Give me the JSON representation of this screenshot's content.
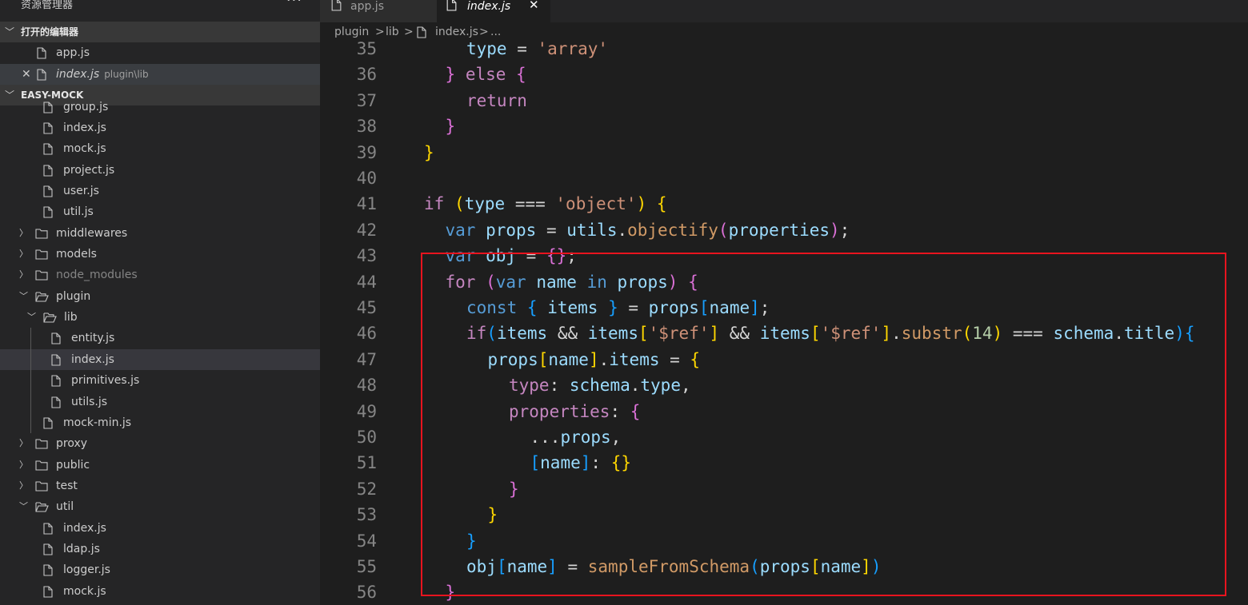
{
  "explorer": {
    "title": "资源管理器",
    "more": "···",
    "open_editors_title": "打开的编辑器",
    "open_editors": [
      {
        "name": "app.js",
        "desc": ""
      },
      {
        "name": "index.js",
        "desc": "plugin\\lib",
        "active": true
      }
    ],
    "project_title": "EASY-MOCK",
    "tree": [
      {
        "name": "group.js",
        "type": "file",
        "depth": 1
      },
      {
        "name": "index.js",
        "type": "file",
        "depth": 1
      },
      {
        "name": "mock.js",
        "type": "file",
        "depth": 1
      },
      {
        "name": "project.js",
        "type": "file",
        "depth": 1
      },
      {
        "name": "user.js",
        "type": "file",
        "depth": 1
      },
      {
        "name": "util.js",
        "type": "file",
        "depth": 1
      },
      {
        "name": "middlewares",
        "type": "folder",
        "depth": 0
      },
      {
        "name": "models",
        "type": "folder",
        "depth": 0
      },
      {
        "name": "node_modules",
        "type": "folder",
        "depth": 0,
        "dim": true
      },
      {
        "name": "plugin",
        "type": "folder-open",
        "depth": 0
      },
      {
        "name": "lib",
        "type": "folder-open",
        "depth": 1
      },
      {
        "name": "entity.js",
        "type": "file",
        "depth": 2
      },
      {
        "name": "index.js",
        "type": "file",
        "depth": 2,
        "selected": true
      },
      {
        "name": "primitives.js",
        "type": "file",
        "depth": 2
      },
      {
        "name": "utils.js",
        "type": "file",
        "depth": 2
      },
      {
        "name": "mock-min.js",
        "type": "file",
        "depth": 1
      },
      {
        "name": "proxy",
        "type": "folder",
        "depth": 0
      },
      {
        "name": "public",
        "type": "folder",
        "depth": 0
      },
      {
        "name": "test",
        "type": "folder",
        "depth": 0
      },
      {
        "name": "util",
        "type": "folder-open",
        "depth": 0
      },
      {
        "name": "index.js",
        "type": "file",
        "depth": 1
      },
      {
        "name": "ldap.js",
        "type": "file",
        "depth": 1
      },
      {
        "name": "logger.js",
        "type": "file",
        "depth": 1
      },
      {
        "name": "mock.js",
        "type": "file",
        "depth": 1
      }
    ]
  },
  "tabs": [
    {
      "label": "app.js",
      "active": false
    },
    {
      "label": "index.js",
      "active": true,
      "close": "✕"
    }
  ],
  "breadcrumb": {
    "p1": "plugin",
    "sep": ">",
    "p2": "lib",
    "p3": "index.js",
    "p4": "..."
  },
  "editor": {
    "lines": [
      {
        "n": "35",
        "indent": 2,
        "tokens": [
          [
            "vr",
            "type"
          ],
          [
            "pu",
            " = "
          ],
          [
            "st",
            "'array'"
          ]
        ]
      },
      {
        "n": "36",
        "indent": 1,
        "tokens": [
          [
            "b2",
            "}"
          ],
          [
            "pu",
            " "
          ],
          [
            "kw",
            "else"
          ],
          [
            "pu",
            " "
          ],
          [
            "b2",
            "{"
          ]
        ]
      },
      {
        "n": "37",
        "indent": 2,
        "tokens": [
          [
            "kw",
            "return"
          ]
        ]
      },
      {
        "n": "38",
        "indent": 1,
        "tokens": [
          [
            "b2",
            "}"
          ]
        ]
      },
      {
        "n": "39",
        "indent": 0,
        "tokens": [
          [
            "b1",
            "}"
          ]
        ]
      },
      {
        "n": "40",
        "indent": 0,
        "tokens": []
      },
      {
        "n": "41",
        "indent": 0,
        "tokens": [
          [
            "kw",
            "if"
          ],
          [
            "pu",
            " "
          ],
          [
            "b1",
            "("
          ],
          [
            "vr",
            "type"
          ],
          [
            "pu",
            " === "
          ],
          [
            "st",
            "'object'"
          ],
          [
            "b1",
            ")"
          ],
          [
            "pu",
            " "
          ],
          [
            "b1",
            "{"
          ]
        ]
      },
      {
        "n": "42",
        "indent": 1,
        "tokens": [
          [
            "id",
            "var"
          ],
          [
            "pu",
            " "
          ],
          [
            "vr",
            "props"
          ],
          [
            "pu",
            " = "
          ],
          [
            "vr",
            "utils"
          ],
          [
            "pu",
            "."
          ],
          [
            "fn",
            "objectify"
          ],
          [
            "b2",
            "("
          ],
          [
            "vr",
            "properties"
          ],
          [
            "b2",
            ")"
          ],
          [
            "pu",
            ";"
          ]
        ]
      },
      {
        "n": "43",
        "indent": 1,
        "tokens": [
          [
            "id",
            "var"
          ],
          [
            "pu",
            " "
          ],
          [
            "vr",
            "obj"
          ],
          [
            "pu",
            " = "
          ],
          [
            "b2",
            "{}"
          ],
          [
            "pu",
            ";"
          ]
        ]
      },
      {
        "n": "44",
        "indent": 1,
        "tokens": [
          [
            "kw",
            "for"
          ],
          [
            "pu",
            " "
          ],
          [
            "b2",
            "("
          ],
          [
            "id",
            "var"
          ],
          [
            "pu",
            " "
          ],
          [
            "vr",
            "name"
          ],
          [
            "pu",
            " "
          ],
          [
            "id",
            "in"
          ],
          [
            "pu",
            " "
          ],
          [
            "vr",
            "props"
          ],
          [
            "b2",
            ")"
          ],
          [
            "pu",
            " "
          ],
          [
            "b2",
            "{"
          ]
        ]
      },
      {
        "n": "45",
        "indent": 2,
        "tokens": [
          [
            "id",
            "const"
          ],
          [
            "pu",
            " "
          ],
          [
            "b3",
            "{"
          ],
          [
            "pu",
            " "
          ],
          [
            "vr",
            "items"
          ],
          [
            "pu",
            " "
          ],
          [
            "b3",
            "}"
          ],
          [
            "pu",
            " = "
          ],
          [
            "vr",
            "props"
          ],
          [
            "b3",
            "["
          ],
          [
            "vr",
            "name"
          ],
          [
            "b3",
            "]"
          ],
          [
            "pu",
            ";"
          ]
        ]
      },
      {
        "n": "46",
        "indent": 2,
        "tokens": [
          [
            "kw",
            "if"
          ],
          [
            "b3",
            "("
          ],
          [
            "vr",
            "items"
          ],
          [
            "pu",
            " && "
          ],
          [
            "vr",
            "items"
          ],
          [
            "b1",
            "["
          ],
          [
            "st",
            "'$ref'"
          ],
          [
            "b1",
            "]"
          ],
          [
            "pu",
            " && "
          ],
          [
            "vr",
            "items"
          ],
          [
            "b1",
            "["
          ],
          [
            "st",
            "'$ref'"
          ],
          [
            "b1",
            "]"
          ],
          [
            "pu",
            "."
          ],
          [
            "fn",
            "substr"
          ],
          [
            "b1",
            "("
          ],
          [
            "nm",
            "14"
          ],
          [
            "b1",
            ")"
          ],
          [
            "pu",
            " === "
          ],
          [
            "vr",
            "schema"
          ],
          [
            "pu",
            "."
          ],
          [
            "vr",
            "title"
          ],
          [
            "b3",
            ")"
          ],
          [
            "b3",
            "{"
          ]
        ]
      },
      {
        "n": "47",
        "indent": 3,
        "tokens": [
          [
            "vr",
            "props"
          ],
          [
            "b1",
            "["
          ],
          [
            "vr",
            "name"
          ],
          [
            "b1",
            "]"
          ],
          [
            "pu",
            "."
          ],
          [
            "vr",
            "items"
          ],
          [
            "pu",
            " = "
          ],
          [
            "b1",
            "{"
          ]
        ]
      },
      {
        "n": "48",
        "indent": 4,
        "tokens": [
          [
            "kw",
            "type"
          ],
          [
            "pu",
            ": "
          ],
          [
            "vr",
            "schema"
          ],
          [
            "pu",
            "."
          ],
          [
            "vr",
            "type"
          ],
          [
            "pu",
            ","
          ]
        ]
      },
      {
        "n": "49",
        "indent": 4,
        "tokens": [
          [
            "kw",
            "properties"
          ],
          [
            "pu",
            ": "
          ],
          [
            "b2",
            "{"
          ]
        ]
      },
      {
        "n": "50",
        "indent": 5,
        "tokens": [
          [
            "pu",
            "..."
          ],
          [
            "vr",
            "props"
          ],
          [
            "pu",
            ","
          ]
        ]
      },
      {
        "n": "51",
        "indent": 5,
        "tokens": [
          [
            "b3",
            "["
          ],
          [
            "vr",
            "name"
          ],
          [
            "b3",
            "]"
          ],
          [
            "pu",
            ": "
          ],
          [
            "b1",
            "{}"
          ]
        ]
      },
      {
        "n": "52",
        "indent": 4,
        "tokens": [
          [
            "b2",
            "}"
          ]
        ]
      },
      {
        "n": "53",
        "indent": 3,
        "tokens": [
          [
            "b1",
            "}"
          ]
        ]
      },
      {
        "n": "54",
        "indent": 2,
        "tokens": [
          [
            "b3",
            "}"
          ]
        ]
      },
      {
        "n": "55",
        "indent": 2,
        "tokens": [
          [
            "vr",
            "obj"
          ],
          [
            "b3",
            "["
          ],
          [
            "vr",
            "name"
          ],
          [
            "b3",
            "]"
          ],
          [
            "pu",
            " = "
          ],
          [
            "fn",
            "sampleFromSchema"
          ],
          [
            "b3",
            "("
          ],
          [
            "vr",
            "props"
          ],
          [
            "b1",
            "["
          ],
          [
            "vr",
            "name"
          ],
          [
            "b1",
            "]"
          ],
          [
            "b3",
            ")"
          ]
        ]
      },
      {
        "n": "56",
        "indent": 1,
        "tokens": [
          [
            "b2",
            "}"
          ]
        ]
      }
    ]
  },
  "colors": {
    "highlight_box": "#e8141f",
    "background": "#1e1e1e",
    "sidebar": "#252526"
  }
}
